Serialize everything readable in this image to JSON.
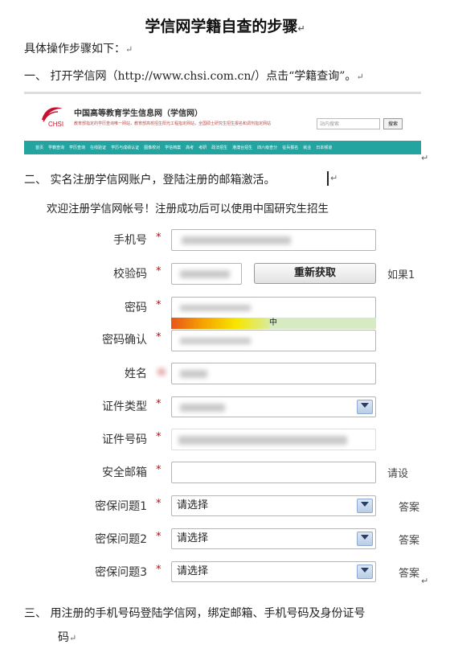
{
  "doc": {
    "title": "学信网学籍自查的步骤",
    "intro": "具体操作步骤如下：",
    "step1": "一、  打开学信网（http://www.chsi.com.cn/）点击“学籍查询”。",
    "step2": "二、  实名注册学信网账户，登陆注册的邮箱激活。",
    "step3_line1": "三、  用注册的手机号码登陆学信网，绑定邮箱、手机号码及身份证号",
    "step3_line2": "码",
    "return_mark": "↵"
  },
  "site": {
    "logo_text": "CHSI",
    "name": "中国高等教育学生信息网（学信网）",
    "description": "教育部指定的学历查询唯一网站，教育部高校招生阳光工程指定网站，全国硕士研究生招生报名和调剂指定网站",
    "search_placeholder": "站内搜索",
    "search_button": "搜索",
    "nav": [
      "首页",
      "学籍查询",
      "学历查询",
      "在线验证",
      "学历与成绩认证",
      "图像校对",
      "学信档案",
      "高考",
      "考研",
      "政法招生",
      "港澳台招生",
      "四六级查分",
      "征兵报名",
      "就业",
      "日本频道"
    ],
    "colors": {
      "nav_bg": "#24a4a0",
      "accent_red": "#c8102e"
    }
  },
  "form": {
    "welcome": "欢迎注册学信网帐号！注册成功后可以使用中国研究生招生",
    "required_mark": "*",
    "labels": {
      "phone": "手机号",
      "code": "校验码",
      "password": "密码",
      "confirm": "密码确认",
      "name": "姓名",
      "id_type": "证件类型",
      "id_number": "证件号码",
      "email": "安全邮箱",
      "q1": "密保问题1",
      "q2": "密保问题2",
      "q3": "密保问题3"
    },
    "resend_button": "重新获取",
    "code_side_text": "如果1",
    "email_side_text": "请设",
    "answer_text": "答案",
    "strength_label": "中",
    "strength_level": 0.48,
    "select_placeholder": "请选择"
  }
}
